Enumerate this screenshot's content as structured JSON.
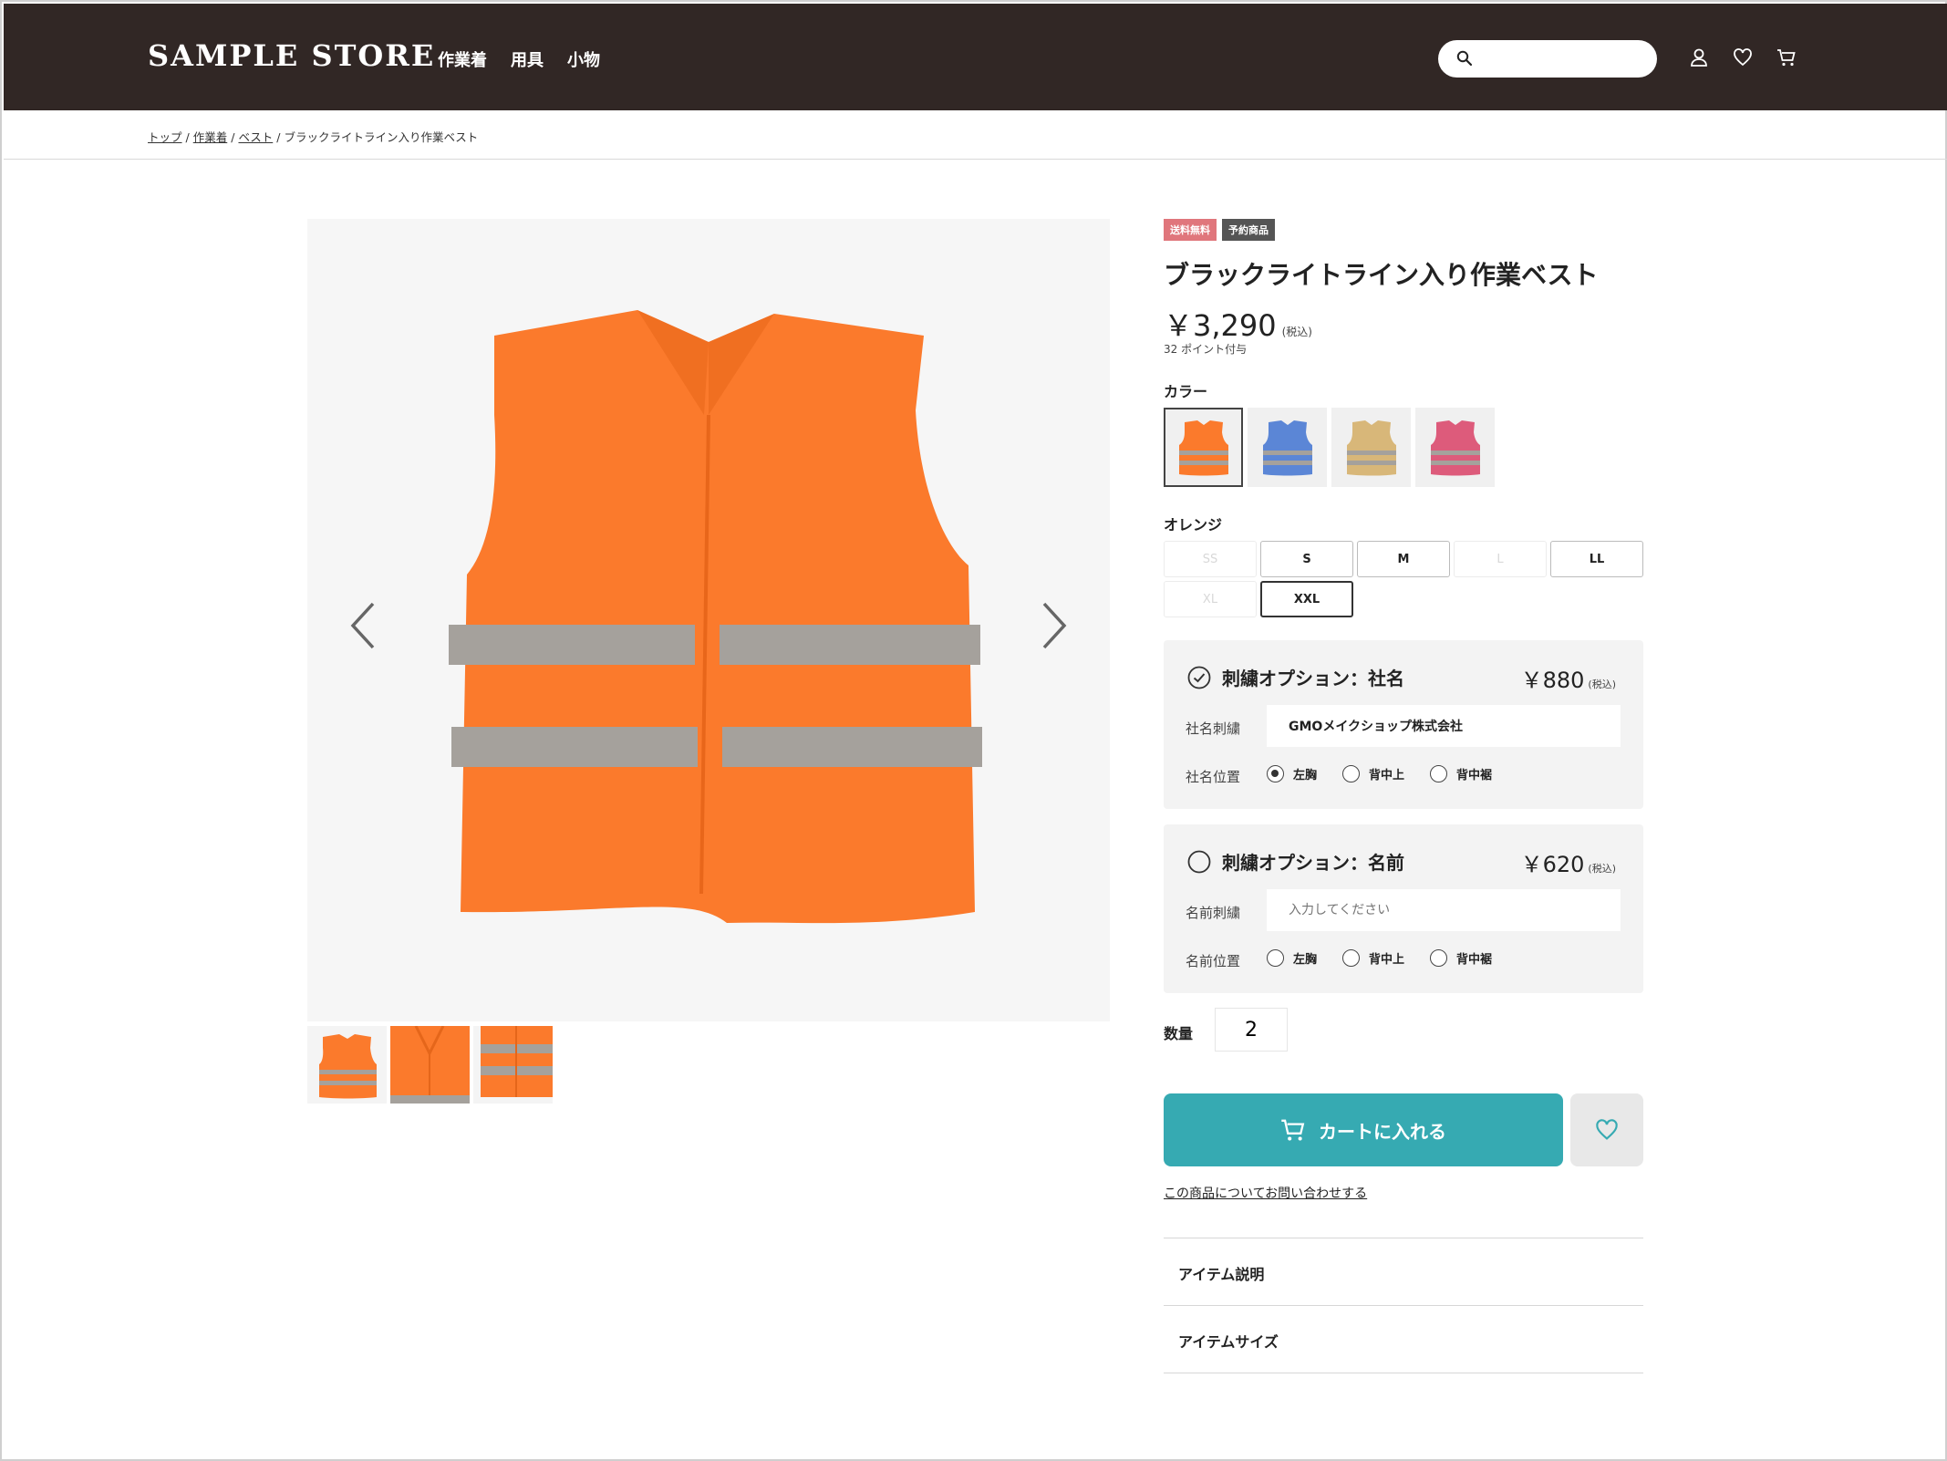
{
  "header": {
    "logo": "SAMPLE STORE",
    "nav": [
      "作業着",
      "用具",
      "小物"
    ],
    "search_placeholder": "",
    "icons": [
      "account-icon",
      "heart-icon",
      "cart-icon"
    ],
    "bg_color": "#312725"
  },
  "breadcrumb": {
    "items": [
      "トップ",
      "作業着",
      "ベスト"
    ],
    "current": "ブラックライトライン入り作業ベスト"
  },
  "product": {
    "badges": [
      "送料無料",
      "予約商品"
    ],
    "title": "ブラックライトライン入り作業ベスト",
    "price": "￥3,290",
    "tax_note": "(税込)",
    "points": "32 ポイント付与",
    "color_label": "カラー",
    "colors": [
      {
        "name": "orange",
        "hex": "#fb7a2c",
        "selected": true
      },
      {
        "name": "blue",
        "hex": "#5b86d6",
        "selected": false
      },
      {
        "name": "beige",
        "hex": "#d8b779",
        "selected": false
      },
      {
        "name": "pink",
        "hex": "#dd5b7b",
        "selected": false
      }
    ],
    "selected_color": "オレンジ",
    "sizes": [
      {
        "label": "SS",
        "available": false,
        "selected": false
      },
      {
        "label": "S",
        "available": true,
        "selected": false
      },
      {
        "label": "M",
        "available": true,
        "selected": false
      },
      {
        "label": "L",
        "available": false,
        "selected": false
      },
      {
        "label": "LL",
        "available": true,
        "selected": false
      },
      {
        "label": "XL",
        "available": false,
        "selected": false
      },
      {
        "label": "XXL",
        "available": true,
        "selected": true
      }
    ]
  },
  "options": [
    {
      "title": "刺繍オプション：社名",
      "checked": true,
      "price": "￥880",
      "tax_note": "(税込)",
      "field_label": "社名刺繍",
      "field_value": "GMOメイクショップ株式会社",
      "field_placeholder": "",
      "position_label": "社名位置",
      "positions": [
        "左胸",
        "背中上",
        "背中裾"
      ],
      "selected_position": 0
    },
    {
      "title": "刺繍オプション：名前",
      "checked": false,
      "price": "￥620",
      "tax_note": "(税込)",
      "field_label": "名前刺繍",
      "field_value": "",
      "field_placeholder": "入力してください",
      "position_label": "名前位置",
      "positions": [
        "左胸",
        "背中上",
        "背中裾"
      ],
      "selected_position": -1
    }
  ],
  "quantity": {
    "label": "数量",
    "value": "2"
  },
  "actions": {
    "cart_label": "カートに入れる",
    "cart_color": "#36aab2",
    "inquiry": "この商品についてお問い合わせする"
  },
  "accordions": [
    "アイテム説明",
    "アイテムサイズ"
  ]
}
